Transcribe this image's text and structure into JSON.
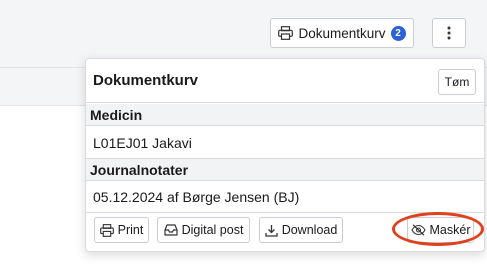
{
  "header": {
    "basket_button_label": "Dokumentkurv",
    "basket_count": "2",
    "more_icon": "vertical-ellipsis-icon"
  },
  "panel": {
    "title": "Dokumentkurv",
    "clear_label": "Tøm",
    "sections": [
      {
        "heading": "Medicin",
        "item": "L01EJ01 Jakavi"
      },
      {
        "heading": "Journalnotater",
        "item": "05.12.2024 af Børge Jensen (BJ)"
      }
    ],
    "actions": {
      "print_label": "Print",
      "digital_post_label": "Digital post",
      "download_label": "Download",
      "mask_label": "Maskér"
    }
  },
  "colors": {
    "badge": "#2a62d6",
    "highlight_ring": "#e0401c"
  }
}
